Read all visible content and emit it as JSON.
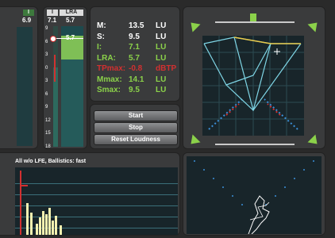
{
  "meters": {
    "left_col_label": "I",
    "left_col_value": "6.9",
    "meter_i_label": "I",
    "meter_i_value": "7.1",
    "meter_lra_label": "LRA",
    "meter_lra_value": "5.7",
    "marker_value": "5.7",
    "scale": [
      "9",
      "6",
      "3",
      "0",
      "3",
      "6",
      "9",
      "12",
      "15",
      "18"
    ]
  },
  "readout": {
    "rows": [
      {
        "label": "M:",
        "value": "13.5",
        "unit": "LU",
        "color": "#ffffff"
      },
      {
        "label": "S:",
        "value": "9.5",
        "unit": "LU",
        "color": "#ffffff"
      },
      {
        "label": "I:",
        "value": "7.1",
        "unit": "LU",
        "color": "#8bd14a"
      },
      {
        "label": "LRA:",
        "value": "5.7",
        "unit": "LU",
        "color": "#8bd14a"
      },
      {
        "label": "TPmax:",
        "value": "-0.8",
        "unit": "dBTP",
        "color": "#d23030"
      },
      {
        "label": "Mmax:",
        "value": "14.1",
        "unit": "LU",
        "color": "#8bd14a"
      },
      {
        "label": "Smax:",
        "value": "9.5",
        "unit": "LU",
        "color": "#8bd14a"
      }
    ]
  },
  "controls": {
    "start_label": "Start",
    "stop_label": "Stop",
    "reset_label": "Reset Loudness"
  },
  "histogram": {
    "title": "All w/o LFE, Ballistics: fast"
  },
  "colors": {
    "meter_green": "#8bd14a",
    "alert_red": "#d23030",
    "scope_bg": "#18252a",
    "histogram_bar": "#f3f0b0"
  }
}
